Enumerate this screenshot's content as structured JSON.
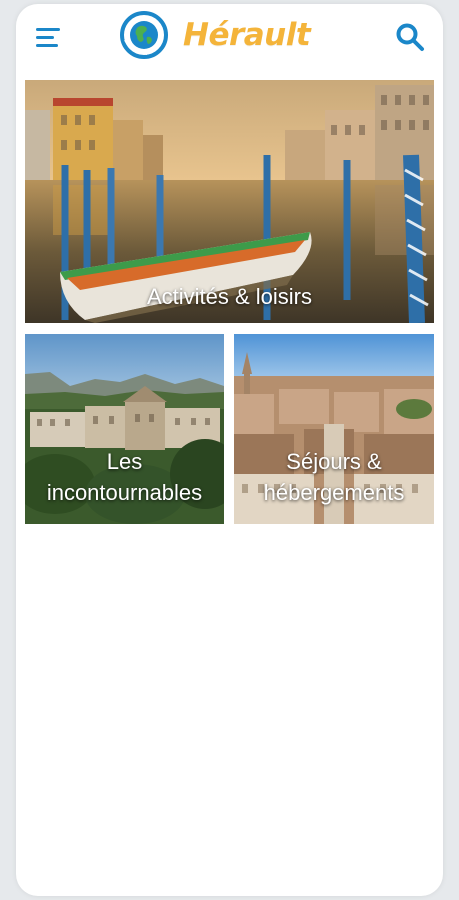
{
  "app": {
    "title": "Hérault"
  },
  "header": {
    "menu_icon": "menu-icon",
    "logo_icon": "globe-logo-icon",
    "search_icon": "search-icon"
  },
  "tiles": [
    {
      "label": "Activités & loisirs"
    },
    {
      "label_line1": "Les",
      "label_line2": "incontournables"
    },
    {
      "label_line1": "Séjours &",
      "label_line2": "hébergements"
    }
  ],
  "colors": {
    "accent_blue": "#1b87c9",
    "logo_yellow": "#f4b43a",
    "logo_green": "#4caf50"
  }
}
